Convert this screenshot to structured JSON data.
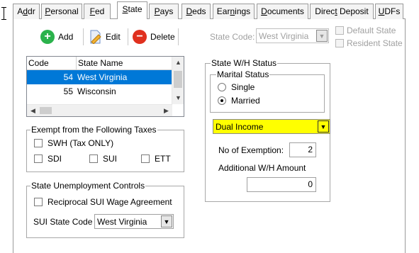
{
  "tabs": [
    {
      "label": "Addr",
      "u": "d",
      "active": false
    },
    {
      "label": "Personal",
      "u": "P",
      "active": false
    },
    {
      "label": "Fed",
      "u": "F",
      "active": false
    },
    {
      "label": "State",
      "u": "S",
      "active": true
    },
    {
      "label": "Pays",
      "u": "P",
      "active": false
    },
    {
      "label": "Deds",
      "u": "D",
      "active": false
    },
    {
      "label": "Earnings",
      "u": "n",
      "active": false
    },
    {
      "label": "Documents",
      "u": "D",
      "active": false
    },
    {
      "label": "Direct Deposit",
      "u": "t",
      "active": false
    },
    {
      "label": "UDFs",
      "u": "U",
      "active": false
    }
  ],
  "toolbar": {
    "add_label": "Add",
    "edit_label": "Edit",
    "delete_label": "Delete",
    "state_code_label": "State Code:",
    "state_code_value": "West Virginia",
    "default_state_label": "Default State",
    "resident_state_label": "Resident State"
  },
  "state_list": {
    "headers": [
      "Code",
      "State Name"
    ],
    "rows": [
      {
        "code": "54",
        "name": "West Virginia",
        "selected": true
      },
      {
        "code": "55",
        "name": "Wisconsin",
        "selected": false
      }
    ]
  },
  "exempt": {
    "title": "Exempt from the Following Taxes",
    "swh_label": "SWH (Tax ONLY)",
    "sdi_label": "SDI",
    "sui_label": "SUI",
    "ett_label": "ETT"
  },
  "unemployment": {
    "title": "State Unemployment Controls",
    "reciprocal_label": "Reciprocal SUI Wage Agreement",
    "sui_state_code_label": "SUI State Code",
    "sui_state_code_value": "West Virginia"
  },
  "wh_status": {
    "title": "State W/H Status",
    "marital_title": "Marital Status",
    "single_label": "Single",
    "married_label": "Married",
    "selected_marital": "Married",
    "filing_value": "Dual Income",
    "exemptions_label": "No of Exemption:",
    "exemptions_value": "2",
    "additional_label": "Additional W/H Amount",
    "additional_value": "0"
  },
  "colors": {
    "selection": "#0078d7",
    "highlight": "#ffff00",
    "add_green": "#2bb24c",
    "delete_red": "#e0301e",
    "edit_blue": "#3a7bd5"
  }
}
